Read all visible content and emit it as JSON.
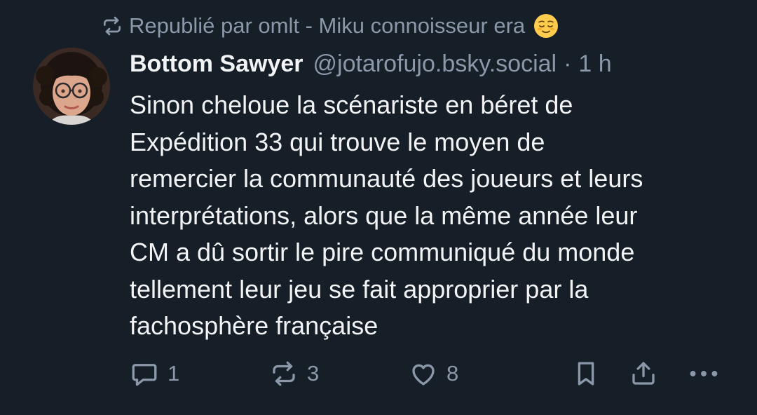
{
  "repost": {
    "text": "Republié par omlt - Miku connoisseur era",
    "icon": "repost-icon",
    "emoji": "relieved-face-emoji"
  },
  "author": {
    "name": "Bottom Sawyer",
    "handle": "@jotarofujo.bsky.social",
    "separator": "·",
    "time": "1 h"
  },
  "post": {
    "lines": [
      "Sinon cheloue la scénariste en béret de",
      "Expédition 33 qui trouve le moyen de",
      "remercier la communauté des joueurs et leurs",
      "interprétations, alors que la même année leur",
      "CM a dû sortir le pire communiqué du monde",
      "tellement leur jeu se fait approprier par la",
      "fachosphère française"
    ]
  },
  "actions": {
    "reply": {
      "icon": "reply-icon",
      "count": "1"
    },
    "repost": {
      "icon": "repost-icon",
      "count": "3"
    },
    "like": {
      "icon": "heart-icon",
      "count": "8"
    },
    "bookmark": {
      "icon": "bookmark-icon"
    },
    "share": {
      "icon": "share-icon"
    },
    "more": {
      "icon": "more-icon"
    }
  },
  "colors": {
    "background": "#161e27",
    "text": "#f1f3f5",
    "muted": "#8b98a9"
  }
}
